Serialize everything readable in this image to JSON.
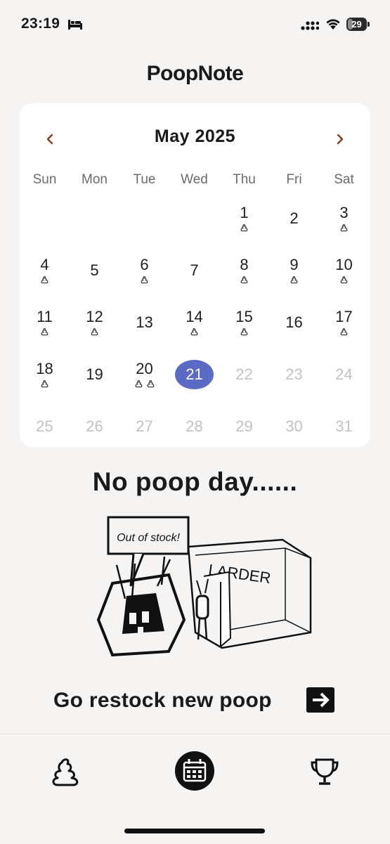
{
  "status_bar": {
    "time": "23:19",
    "battery": "29",
    "battery_level": 0.29,
    "icons": [
      "bed-icon",
      "signal-icon",
      "wifi-icon",
      "battery-icon"
    ]
  },
  "app": {
    "title": "PoopNote"
  },
  "calendar": {
    "month_label": "May 2025",
    "prev_icon": "chevron-left-icon",
    "next_icon": "chevron-right-icon",
    "accent_color": "#8a3a1e",
    "today_color": "#5b6ac4",
    "weekdays": [
      "Sun",
      "Mon",
      "Tue",
      "Wed",
      "Thu",
      "Fri",
      "Sat"
    ],
    "leading_blank_days": 4,
    "today": 21,
    "days": [
      {
        "day": "1",
        "poops": 1
      },
      {
        "day": "2",
        "poops": 0
      },
      {
        "day": "3",
        "poops": 1
      },
      {
        "day": "4",
        "poops": 1
      },
      {
        "day": "5",
        "poops": 0
      },
      {
        "day": "6",
        "poops": 1
      },
      {
        "day": "7",
        "poops": 0
      },
      {
        "day": "8",
        "poops": 1
      },
      {
        "day": "9",
        "poops": 1
      },
      {
        "day": "10",
        "poops": 1
      },
      {
        "day": "11",
        "poops": 1
      },
      {
        "day": "12",
        "poops": 1
      },
      {
        "day": "13",
        "poops": 0
      },
      {
        "day": "14",
        "poops": 1
      },
      {
        "day": "15",
        "poops": 1
      },
      {
        "day": "16",
        "poops": 0
      },
      {
        "day": "17",
        "poops": 1
      },
      {
        "day": "18",
        "poops": 1
      },
      {
        "day": "19",
        "poops": 0
      },
      {
        "day": "20",
        "poops": 2
      },
      {
        "day": "21",
        "poops": 0
      },
      {
        "day": "22",
        "poops": 0
      },
      {
        "day": "23",
        "poops": 0
      },
      {
        "day": "24",
        "poops": 0
      },
      {
        "day": "25",
        "poops": 0
      },
      {
        "day": "26",
        "poops": 0
      },
      {
        "day": "27",
        "poops": 0
      },
      {
        "day": "28",
        "poops": 0
      },
      {
        "day": "29",
        "poops": 0
      },
      {
        "day": "30",
        "poops": 0
      },
      {
        "day": "31",
        "poops": 0
      }
    ]
  },
  "empty_state": {
    "title": "No poop day......",
    "illustration": {
      "speech_bubble": "Out of stock!",
      "sign": "LARDER"
    },
    "button_label": "Go restock new poop",
    "button_icon": "arrow-right-icon"
  },
  "tab_bar": {
    "tabs": [
      {
        "name": "poop",
        "icon": "poop-icon"
      },
      {
        "name": "calendar",
        "icon": "calendar-icon",
        "active": true
      },
      {
        "name": "trophy",
        "icon": "trophy-icon"
      }
    ]
  }
}
